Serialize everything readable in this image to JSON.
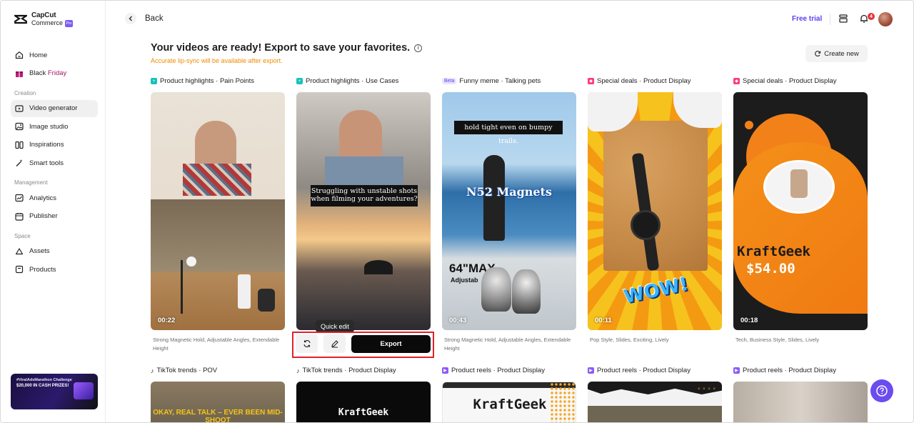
{
  "brand": {
    "name_line1": "CapCut",
    "name_line2": "Commerce",
    "pro": "Pro"
  },
  "sidebar": {
    "items": [
      {
        "label": "Home",
        "icon": "home-icon"
      },
      {
        "label_part1": "Black",
        "label_part2": "Friday",
        "icon": "gift-icon"
      }
    ],
    "sections": [
      {
        "title": "Creation",
        "items": [
          {
            "label": "Video generator",
            "icon": "video-icon",
            "active": true
          },
          {
            "label": "Image studio",
            "icon": "image-icon"
          },
          {
            "label": "Inspirations",
            "icon": "inspiration-icon"
          },
          {
            "label": "Smart tools",
            "icon": "magic-wand-icon"
          }
        ]
      },
      {
        "title": "Management",
        "items": [
          {
            "label": "Analytics",
            "icon": "chart-icon"
          },
          {
            "label": "Publisher",
            "icon": "calendar-icon"
          }
        ]
      },
      {
        "title": "Space",
        "items": [
          {
            "label": "Assets",
            "icon": "cloud-icon"
          },
          {
            "label": "Products",
            "icon": "box-icon"
          }
        ]
      }
    ],
    "promo": {
      "line1": "#ViralAdsMarathon Challenge",
      "line2": "$20,000 IN CASH PRIZES!"
    }
  },
  "header": {
    "back_label": "Back",
    "free_trial": "Free trial",
    "notification_count": "4"
  },
  "main": {
    "title": "Your videos are ready! Export to save your favorites.",
    "subtitle": "Accurate lip-sync will be available after export.",
    "create_new": "Create new"
  },
  "cards": [
    {
      "label": "Product highlights · Pain Points",
      "duration": "00:22",
      "desc": "Strong Magnetic Hold, Adjustable Angles, Extendable Height",
      "tag_color": "#19c2b8"
    },
    {
      "label": "Product highlights · Use Cases",
      "duration": "",
      "desc": "",
      "tag_color": "#19c2b8",
      "caption": "Struggling with unstable shots when filming your adventures?"
    },
    {
      "label": "Funny meme · Talking pets",
      "beta": "Beta",
      "duration": "00:43",
      "desc": "Strong Magnetic Hold, Adjustable Angles, Extendable Height",
      "caption_top": "hold tight even on bumpy trails.",
      "caption_mid": "N52 Magnets",
      "caption_low": "64\"MAX",
      "caption_low2": "Adjustab"
    },
    {
      "label": "Special deals · Product Display",
      "duration": "00:11",
      "desc": "Pop Style, Slides, Exciting, Lively",
      "tag_color": "#ff3b7a",
      "wow": "WOW!"
    },
    {
      "label": "Special deals · Product Display",
      "duration": "00:18",
      "desc": "Tech, Business Style, Slides, Lively",
      "tag_color": "#ff3b7a",
      "brand": "KraftGeek",
      "price": "$54.00"
    }
  ],
  "row2": [
    {
      "label": "TikTok trends · POV",
      "caption": "OKAY, REAL TALK – EVER BEEN MID-SHOOT"
    },
    {
      "label": "TikTok trends · Product Display",
      "caption": "KraftGeek"
    },
    {
      "label": "Product reels · Product Display",
      "caption": "KraftGeek"
    },
    {
      "label": "Product reels · Product Display"
    },
    {
      "label": "Product reels · Product Display"
    }
  ],
  "actions": {
    "tooltip": "Quick edit",
    "export": "Export"
  }
}
